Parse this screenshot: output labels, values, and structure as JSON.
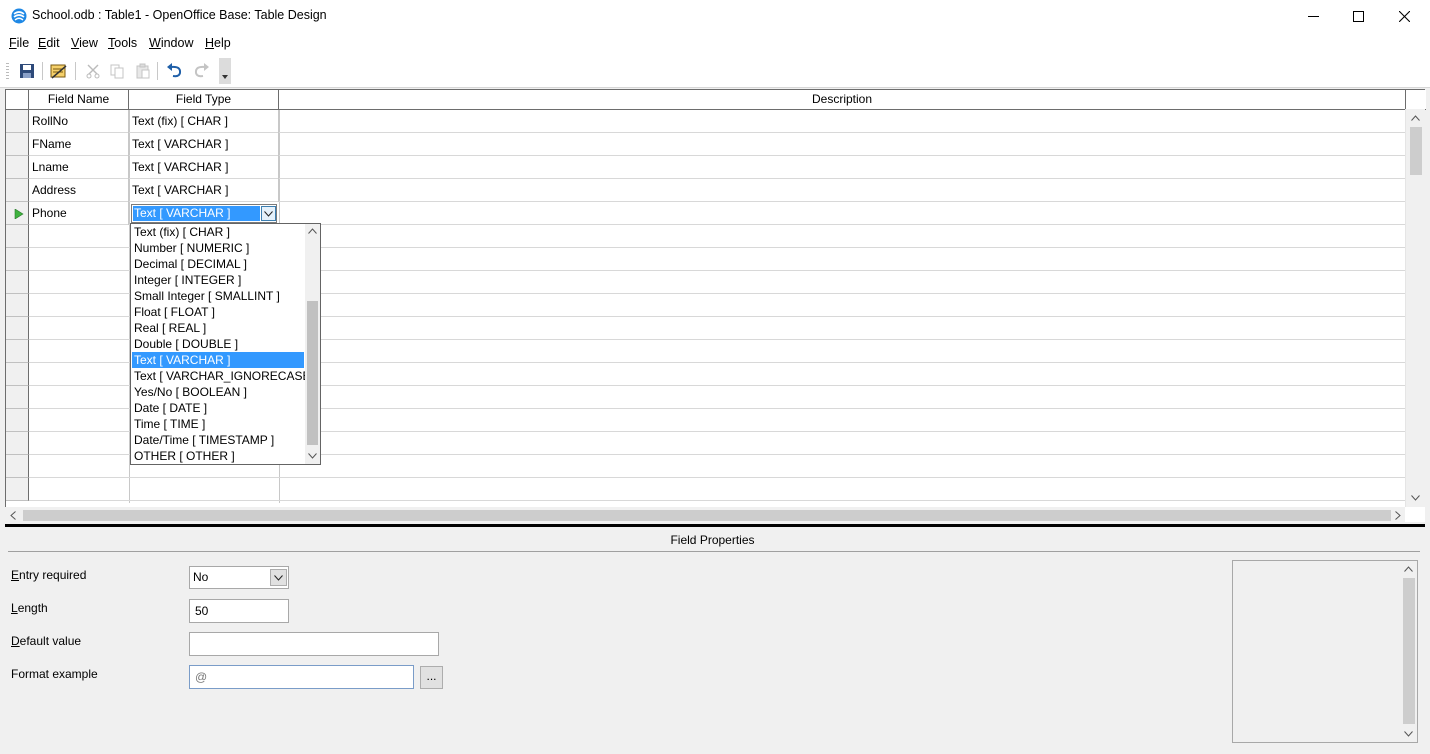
{
  "window": {
    "title": "School.odb : Table1 - OpenOffice Base: Table Design"
  },
  "menu": [
    {
      "key": "F",
      "rest": "ile"
    },
    {
      "key": "E",
      "rest": "dit"
    },
    {
      "key": "V",
      "rest": "iew"
    },
    {
      "key": "T",
      "rest": "ools"
    },
    {
      "key": "W",
      "rest": "indow"
    },
    {
      "key": "H",
      "rest": "elp"
    }
  ],
  "grid": {
    "headers": {
      "field_name": "Field Name",
      "field_type": "Field Type",
      "description": "Description"
    },
    "rows": [
      {
        "name": "RollNo",
        "type": "Text (fix) [ CHAR ]"
      },
      {
        "name": "FName",
        "type": "Text [ VARCHAR ]"
      },
      {
        "name": "Lname",
        "type": "Text [ VARCHAR ]"
      },
      {
        "name": "Address",
        "type": "Text [ VARCHAR ]"
      },
      {
        "name": "Phone",
        "type": "Text [ VARCHAR ]"
      }
    ]
  },
  "type_options": [
    "Text (fix) [ CHAR ]",
    "Number [ NUMERIC ]",
    "Decimal [ DECIMAL ]",
    "Integer [ INTEGER ]",
    "Small Integer [ SMALLINT ]",
    "Float [ FLOAT ]",
    "Real [ REAL ]",
    "Double [ DOUBLE ]",
    "Text [ VARCHAR ]",
    "Text [ VARCHAR_IGNORECASE ]",
    "Yes/No [ BOOLEAN ]",
    "Date [ DATE ]",
    "Time [ TIME ]",
    "Date/Time [ TIMESTAMP ]",
    "OTHER [ OTHER ]"
  ],
  "selected_option": "Text [ VARCHAR ]",
  "properties": {
    "title": "Field Properties",
    "entry_required": {
      "key": "E",
      "rest": "ntry required",
      "value": "No"
    },
    "length": {
      "key": "L",
      "rest": "ength",
      "value": "50"
    },
    "default_value": {
      "key": "D",
      "rest": "efault value",
      "value": ""
    },
    "format_example": {
      "label": "Format example",
      "value": "@",
      "button": "..."
    }
  },
  "colors": {
    "selection": "#3399ff",
    "app_icon": "#1e88e5"
  }
}
